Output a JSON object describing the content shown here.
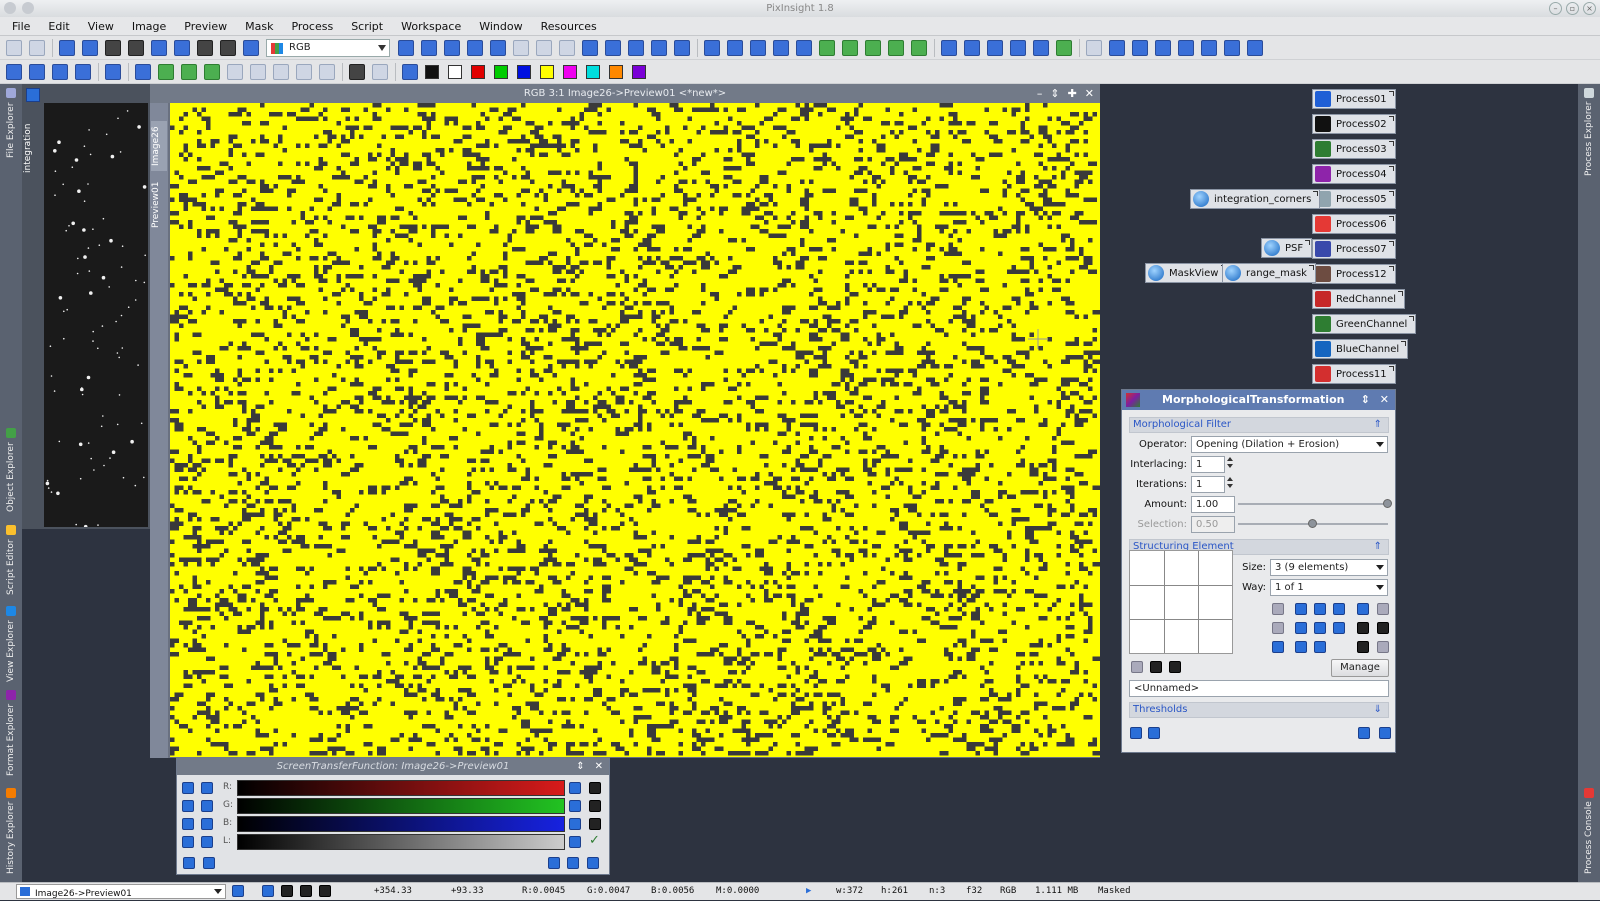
{
  "app": {
    "window_title": "PixInsight 1.8"
  },
  "menu": [
    "File",
    "Edit",
    "View",
    "Image",
    "Preview",
    "Mask",
    "Process",
    "Script",
    "Workspace",
    "Window",
    "Resources"
  ],
  "toolbar": {
    "channel_combo": "RGB",
    "color_buttons": [
      "#111111",
      "#ffffff",
      "#e00000",
      "#00cc00",
      "#0010e0",
      "#ffff00",
      "#ee00ee",
      "#00dddd",
      "#ff8800",
      "#7a00d6"
    ]
  },
  "left_dock_tabs": [
    "File Explorer",
    "Object Explorer",
    "Script Editor",
    "View Explorer",
    "Format Explorer",
    "History Explorer"
  ],
  "right_dock_tabs": [
    "Process Explorer",
    "Process Console"
  ],
  "thumb_panel": {
    "label": "integration"
  },
  "image_window": {
    "title": "RGB 3:1 Image26->Preview01  <*new*>",
    "tabs": [
      "Image26",
      "Preview01"
    ],
    "canvas_color": "#ffff00",
    "dot_color": "#3a3a3a"
  },
  "process_icons": [
    {
      "label": "Process01",
      "color": "#1f5fd6"
    },
    {
      "label": "Process02",
      "color": "#111111"
    },
    {
      "label": "Process03",
      "color": "#2e7d32"
    },
    {
      "label": "Process04",
      "color": "#8e24aa"
    },
    {
      "label": "Process05",
      "color": "#90a4ae"
    },
    {
      "label": "Process06",
      "color": "#e53935"
    },
    {
      "label": "Process07",
      "color": "#3949ab"
    },
    {
      "label": "Process12",
      "color": "#6d4c41"
    },
    {
      "label": "RedChannel",
      "color": "#c62828"
    },
    {
      "label": "GreenChannel",
      "color": "#2e7d32"
    },
    {
      "label": "BlueChannel",
      "color": "#1565c0"
    },
    {
      "label": "Process11",
      "color": "#d32f2f"
    }
  ],
  "instance_icons": [
    "integration_corners",
    "PSF",
    "MaskView",
    "range_mask"
  ],
  "mt_dialog": {
    "title": "MorphologicalTransformation",
    "filter_section": "Morphological Filter",
    "operator_label": "Operator:",
    "operator_value": "Opening (Dilation + Erosion)",
    "interlacing_label": "Interlacing:",
    "interlacing_value": "1",
    "iterations_label": "Iterations:",
    "iterations_value": "1",
    "amount_label": "Amount:",
    "amount_value": "1.00",
    "amount_fraction": 1.0,
    "selection_label": "Selection:",
    "selection_value": "0.50",
    "selection_fraction": 0.5,
    "structuring_section": "Structuring Element",
    "size_label": "Size:",
    "size_value": "3  (9 elements)",
    "way_label": "Way:",
    "way_value": "1 of 1",
    "manage_label": "Manage",
    "element_name": "<Unnamed>",
    "thresholds_section": "Thresholds"
  },
  "stf": {
    "title": "ScreenTransferFunction: Image26->Preview01",
    "channels": [
      {
        "label": "R:",
        "color": "#d81b1b"
      },
      {
        "label": "G:",
        "color": "#22c322"
      },
      {
        "label": "B:",
        "color": "#1722e0"
      },
      {
        "label": "L:",
        "color": "#cccccc"
      }
    ]
  },
  "status": {
    "view": "Image26->Preview01",
    "x": "+354.33",
    "y": "+93.33",
    "r": "R:0.0045",
    "g": "G:0.0047",
    "b": "B:0.0056",
    "m": "M:0.0000",
    "w": "w:372",
    "h": "h:261",
    "n": "n:3",
    "f": "f32",
    "color": "RGB",
    "size": "1.111 MB",
    "mask": "Masked"
  }
}
